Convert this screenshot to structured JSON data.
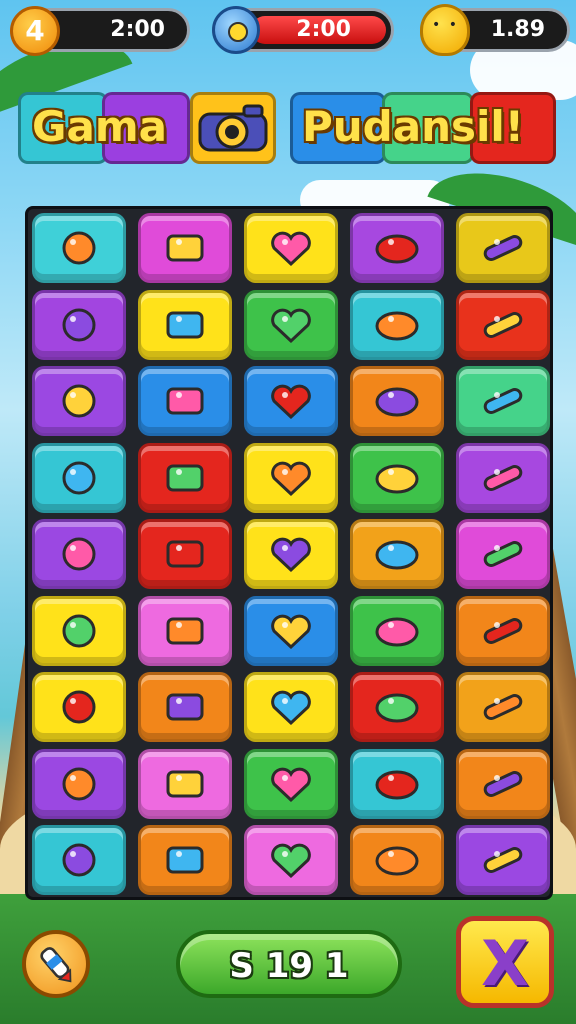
{
  "hud": {
    "level": "4",
    "left_value": "2:00",
    "mid_value": "2:00",
    "right_value": "1.89"
  },
  "title": {
    "left": "Gama",
    "right": "Pudansil!"
  },
  "board": {
    "rows": [
      [
        {
          "color": "#3fd0d8",
          "icon": "treasure-chest-icon"
        },
        {
          "color": "#e04bd9",
          "icon": "green-cat-creature-icon"
        },
        {
          "color": "#ffe21a",
          "icon": "ring-donut-icon"
        },
        {
          "color": "#a748e0",
          "icon": "yellow-eye-creature-icon"
        },
        {
          "color": "#e8c81a",
          "icon": "coffee-cup-icon"
        }
      ],
      [
        {
          "color": "#a245e0",
          "icon": "paintbrush-icon"
        },
        {
          "color": "#ffe21a",
          "icon": "blue-box-icon"
        },
        {
          "color": "#3ec24a",
          "icon": "orange-star-icon"
        },
        {
          "color": "#35c6d4",
          "icon": "pink-puffball-icon"
        },
        {
          "color": "#e8321c",
          "icon": "blue-blob-icon"
        }
      ],
      [
        {
          "color": "#9b48e2",
          "icon": "drum-pot-icon"
        },
        {
          "color": "#2a8ee8",
          "icon": "blue-face-ball-icon"
        },
        {
          "color": "#2a8ee8",
          "icon": "orange-bar-icon"
        },
        {
          "color": "#f2861a",
          "icon": "red-bear-icon"
        },
        {
          "color": "#45d38a",
          "icon": "shield-badge-icon"
        }
      ],
      [
        {
          "color": "#35c6d4",
          "icon": "heart-shield-icon"
        },
        {
          "color": "#e4261e",
          "icon": "purple-plane-icon"
        },
        {
          "color": "#ffe21a",
          "icon": "mushroom-hammer-icon"
        },
        {
          "color": "#3ec24a",
          "icon": "purple-crate-icon"
        },
        {
          "color": "#a748e0",
          "icon": "slingshot-icon"
        }
      ],
      [
        {
          "color": "#9b48e2",
          "icon": "dice-board-icon"
        },
        {
          "color": "#e4261e",
          "icon": "teddy-face-icon"
        },
        {
          "color": "#ffe21a",
          "icon": "red-heart-icon"
        },
        {
          "color": "#f2a21a",
          "icon": "crayon-icon"
        },
        {
          "color": "#e04bd9",
          "icon": "white-blob-icon"
        }
      ],
      [
        {
          "color": "#ffe21a",
          "icon": "purple-heart-icon"
        },
        {
          "color": "#ee6ae0",
          "icon": "purple-fish-icon"
        },
        {
          "color": "#2a8ee8",
          "icon": "pencil-icon"
        },
        {
          "color": "#3ec24a",
          "icon": "orange-cat-icon"
        },
        {
          "color": "#f2861a",
          "icon": "camera-box-icon"
        }
      ],
      [
        {
          "color": "#ffe21a",
          "icon": "green-shovel-icon"
        },
        {
          "color": "#f2861a",
          "icon": "blue-gear-icon"
        },
        {
          "color": "#ffe21a",
          "icon": "blue-hammer-icon"
        },
        {
          "color": "#e4261e",
          "icon": "blue-heart-icon"
        },
        {
          "color": "#f2a21a",
          "icon": "yellow-pencil-icon"
        }
      ],
      [
        {
          "color": "#9b48e2",
          "icon": "cheese-icon"
        },
        {
          "color": "#ee6ae0",
          "icon": "magnifier-icon"
        },
        {
          "color": "#3ec24a",
          "icon": "purple-dice-icon"
        },
        {
          "color": "#35c6d4",
          "icon": "red-bar-icon"
        },
        {
          "color": "#f2861a",
          "icon": "green-flashlight-icon"
        }
      ],
      [
        {
          "color": "#35c6d4",
          "icon": "orange-bottle-icon"
        },
        {
          "color": "#f2861a",
          "icon": "brown-camera-icon"
        },
        {
          "color": "#ee6ae0",
          "icon": "orange-bean-icon"
        },
        {
          "color": "#f2861a",
          "icon": "coiled-rope-icon"
        },
        {
          "color": "#9b48e2",
          "icon": "no-sign-icon"
        }
      ]
    ]
  },
  "bottom": {
    "score": "S 19 1",
    "close": "X"
  }
}
